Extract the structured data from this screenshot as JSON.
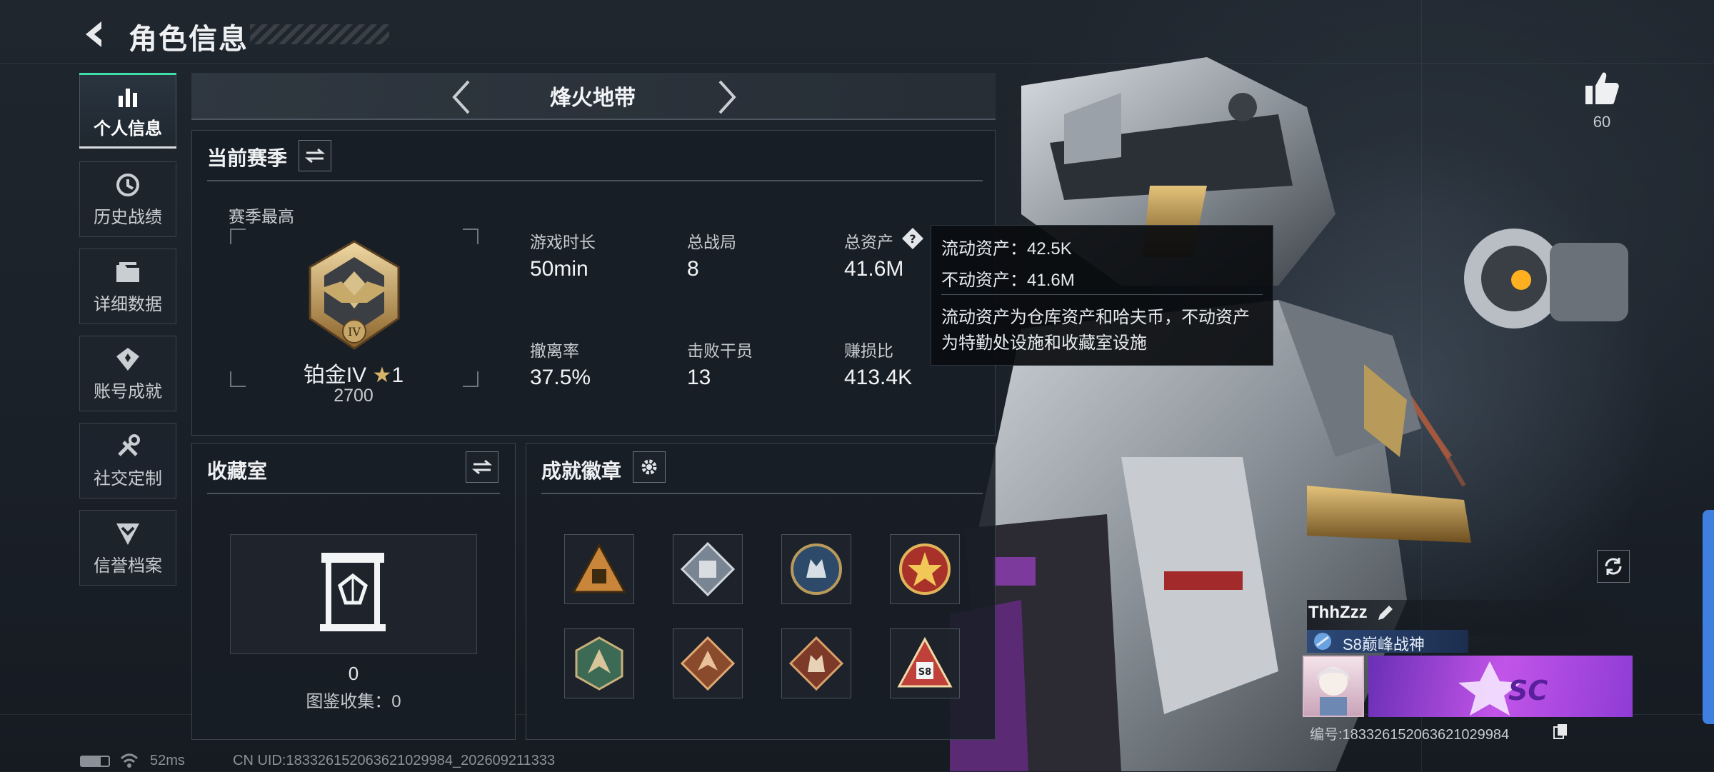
{
  "header": {
    "title": "角色信息"
  },
  "sidebar": {
    "items": [
      {
        "label": "个人信息"
      },
      {
        "label": "历史战绩"
      },
      {
        "label": "详细数据"
      },
      {
        "label": "账号成就"
      },
      {
        "label": "社交定制"
      },
      {
        "label": "信誉档案"
      }
    ]
  },
  "mode": {
    "name": "烽火地带"
  },
  "season": {
    "title": "当前赛季",
    "best_label": "赛季最高",
    "rank": "铂金IV",
    "rank_emblem_text": "IV",
    "stars": "1",
    "score": "2700",
    "stats": [
      {
        "label": "游戏时长",
        "value": "50min"
      },
      {
        "label": "总战局",
        "value": "8"
      },
      {
        "label": "总资产",
        "value": "41.6M"
      },
      {
        "label": "撤离率",
        "value": "37.5%"
      },
      {
        "label": "击败干员",
        "value": "13"
      },
      {
        "label": "赚损比",
        "value": "413.4K"
      }
    ]
  },
  "tooltip": {
    "liquid": "流动资产：42.5K",
    "fixed": "不动资产：41.6M",
    "desc1": "流动资产为仓库资产和哈夫币，不动资产",
    "desc2": "为特勤处设施和收藏室设施"
  },
  "collection": {
    "title": "收藏室",
    "count": "0",
    "codex": "图鉴收集：0"
  },
  "badges": {
    "title": "成就徽章",
    "items": [
      {
        "icon": "pyramid-bunker-badge"
      },
      {
        "icon": "armored-fist-badge"
      },
      {
        "icon": "wolf-round-badge"
      },
      {
        "icon": "star-eagle-badge"
      },
      {
        "icon": "dragon-hexagon-badge"
      },
      {
        "icon": "dragon-diamond-badge"
      },
      {
        "icon": "wolf-diamond-badge"
      },
      {
        "icon": "s8-triangle-badge",
        "text": "S8"
      }
    ]
  },
  "likes": {
    "count": "60"
  },
  "player": {
    "name": "ThhZzz",
    "title": "S8巅峰战神",
    "id": "编号:1833261520636210299​84",
    "banner_text": "SC"
  },
  "status_bar": {
    "ping": "52ms",
    "uid": "CN UID:1833261520636210299​84_202609211333"
  },
  "colors": {
    "accent": "#3fe0a8",
    "rank_star": "#d6b46a",
    "panel_bg": "#181e25"
  }
}
